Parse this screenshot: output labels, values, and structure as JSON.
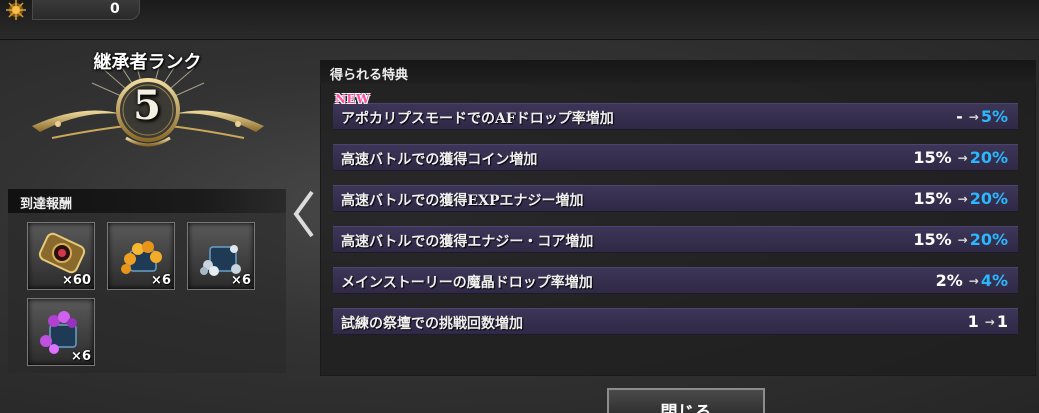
{
  "top_bar": {
    "currency_value": "0",
    "currency_icon": "coin-sun-icon"
  },
  "rank": {
    "title": "継承者ランク",
    "number": "5"
  },
  "rewards": {
    "header": "到達報酬",
    "items": [
      {
        "icon": "gold-ring-token-icon",
        "qty": "×60"
      },
      {
        "icon": "gold-crystal-chest-icon",
        "qty": "×6"
      },
      {
        "icon": "silver-crystal-chest-icon",
        "qty": "×6"
      },
      {
        "icon": "purple-crystal-chest-icon",
        "qty": "×6"
      }
    ]
  },
  "benefits": {
    "header": "得られる特典",
    "new_badge": "NEW",
    "rows": [
      {
        "label": "アポカリプスモードでのAFドロップ率増加",
        "from": "-",
        "to": "5%",
        "changed": true
      },
      {
        "label": "高速バトルでの獲得コイン増加",
        "from": "15%",
        "to": "20%",
        "changed": true
      },
      {
        "label": "高速バトルでの獲得EXPエナジー増加",
        "from": "15%",
        "to": "20%",
        "changed": true
      },
      {
        "label": "高速バトルでの獲得エナジー・コア増加",
        "from": "15%",
        "to": "20%",
        "changed": true
      },
      {
        "label": "メインストーリーの魔晶ドロップ率増加",
        "from": "2%",
        "to": "4%",
        "changed": true
      },
      {
        "label": "試練の祭壇での挑戦回数増加",
        "from": "1",
        "to": "1",
        "changed": false
      }
    ],
    "arrow": "→"
  },
  "close_button": {
    "label": "閉じる"
  },
  "colors": {
    "row_bg": "#3d3658",
    "value_up": "#2ab8ff",
    "new_badge": "#ff4fa0"
  }
}
